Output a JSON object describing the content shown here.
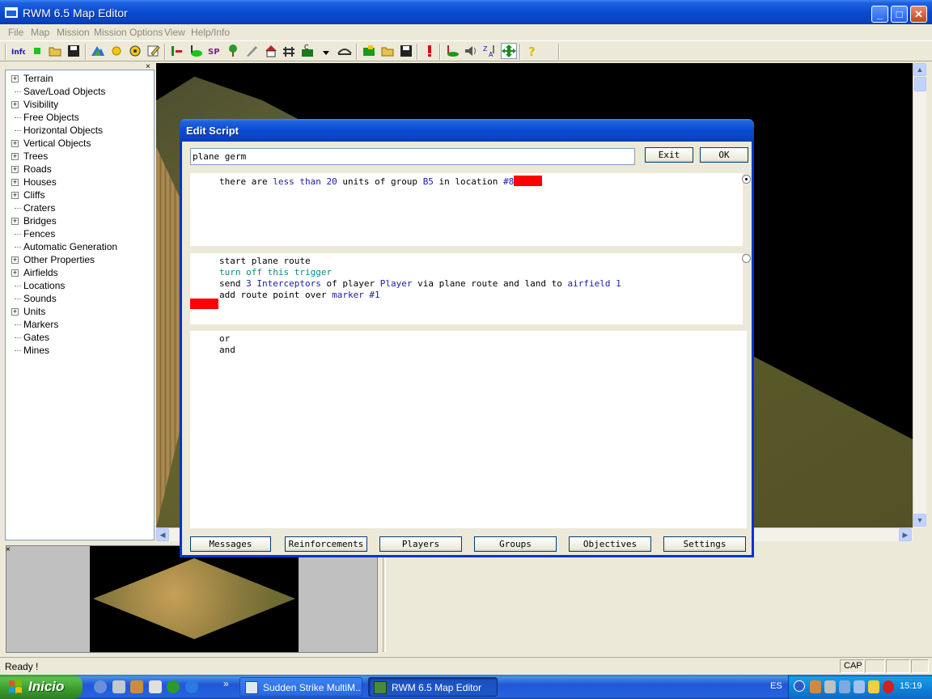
{
  "window": {
    "title": "RWM 6.5 Map Editor",
    "minimize_glyph": "_",
    "maximize_glyph": "□",
    "close_glyph": "✕"
  },
  "menu": [
    "File",
    "Map",
    "Mission",
    "Mission Options",
    "View",
    "Help/Info"
  ],
  "toolbar": {
    "buttons": [
      "info-icon",
      "new-icon",
      "open-icon",
      "save-icon",
      "terrain-icon",
      "sun-icon",
      "settings-icon",
      "edit-icon",
      "units-icon",
      "shape-icon",
      "sp-icon",
      "tree-icon",
      "brush-icon",
      "house-icon",
      "fence-icon",
      "c-icon",
      "dropdown-icon",
      "bridge-icon",
      "green-folder-icon",
      "folder-icon",
      "save-floppy-icon",
      "alert-icon",
      "unit-place-icon",
      "sound-icon",
      "sort-icon",
      "move-icon",
      "help-icon"
    ]
  },
  "tree": {
    "close_glyph": "×",
    "items": [
      {
        "label": "Terrain",
        "expandable": true
      },
      {
        "label": "Save/Load Objects",
        "expandable": false
      },
      {
        "label": "Visibility",
        "expandable": true
      },
      {
        "label": "Free Objects",
        "expandable": false
      },
      {
        "label": "Horizontal Objects",
        "expandable": false
      },
      {
        "label": "Vertical Objects",
        "expandable": true
      },
      {
        "label": "Trees",
        "expandable": true
      },
      {
        "label": "Roads",
        "expandable": true
      },
      {
        "label": "Houses",
        "expandable": true
      },
      {
        "label": "Cliffs",
        "expandable": true
      },
      {
        "label": "Craters",
        "expandable": false
      },
      {
        "label": "Bridges",
        "expandable": true
      },
      {
        "label": "Fences",
        "expandable": false
      },
      {
        "label": "Automatic Generation",
        "expandable": false
      },
      {
        "label": "Other Properties",
        "expandable": true
      },
      {
        "label": "Airfields",
        "expandable": true
      },
      {
        "label": "Locations",
        "expandable": false
      },
      {
        "label": "Sounds",
        "expandable": false
      },
      {
        "label": "Units",
        "expandable": true
      },
      {
        "label": "Markers",
        "expandable": false
      },
      {
        "label": "Gates",
        "expandable": false
      },
      {
        "label": "Mines",
        "expandable": false
      }
    ],
    "expand_glyph": "+"
  },
  "minimap": {
    "close_glyph": "×"
  },
  "status": {
    "text": "Ready !",
    "cells": [
      "CAP",
      "",
      "",
      ""
    ]
  },
  "dialog": {
    "title": "Edit Script",
    "script_name": "plane germ",
    "exit_label": "Exit",
    "ok_label": "OK",
    "conditions": [
      [
        {
          "t": "there are ",
          "c": "black"
        },
        {
          "t": "less than 20",
          "c": "blue"
        },
        {
          "t": " units of group ",
          "c": "black"
        },
        {
          "t": "B5",
          "c": "blue"
        },
        {
          "t": " in location ",
          "c": "black"
        },
        {
          "t": "#8",
          "c": "blue"
        }
      ]
    ],
    "actions": [
      [
        {
          "t": "start plane route",
          "c": "black"
        }
      ],
      [
        {
          "t": "turn off this trigger",
          "c": "teal"
        }
      ],
      [
        {
          "t": "send ",
          "c": "black"
        },
        {
          "t": "3 Interceptors",
          "c": "blue"
        },
        {
          "t": " of player ",
          "c": "black"
        },
        {
          "t": "Player",
          "c": "blue"
        },
        {
          "t": " via plane route and land to ",
          "c": "black"
        },
        {
          "t": "airfield 1",
          "c": "blue"
        }
      ],
      [
        {
          "t": "add route point over ",
          "c": "black"
        },
        {
          "t": "marker #1",
          "c": "blue"
        }
      ]
    ],
    "logic_options": [
      "or",
      "and"
    ],
    "tab_buttons": [
      "Messages",
      "Reinforcements",
      "Players",
      "Groups",
      "Objectives",
      "Settings"
    ]
  },
  "taskbar": {
    "start_label": "Inicio",
    "quicklaunch_more": "»",
    "tasks": [
      {
        "label": "Sudden Strike MultiM...",
        "active": false
      },
      {
        "label": "RWM 6.5 Map Editor",
        "active": true
      }
    ],
    "language": "ES",
    "clock": "15:19"
  },
  "colors": {
    "xp_blue": "#0a4bd4",
    "marker_red": "#ff0000",
    "script_blue": "#1a1aa6",
    "script_teal": "#0a8a8a"
  }
}
